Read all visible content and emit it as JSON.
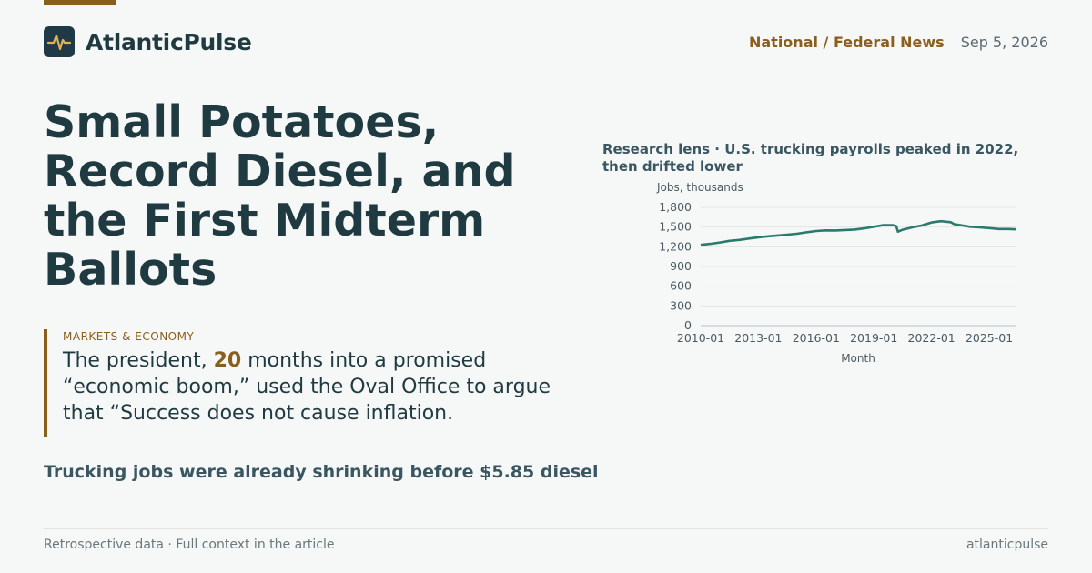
{
  "brand": {
    "name": "AtlanticPulse",
    "logo_icon": "pulse-icon"
  },
  "header": {
    "section": "National / Federal News",
    "date": "Sep 5, 2026"
  },
  "headline": "Small Potatoes, Record Diesel, and the First Midterm Ballots",
  "quote_block": {
    "kicker": "MARKETS & ECONOMY",
    "text_before": "The president, ",
    "highlight": "20",
    "text_after": " months into a promised “economic boom,” used the Oval Office to argue that “Success does not cause inflation."
  },
  "subhead": "Trucking jobs were already shrinking before $5.85 diesel",
  "footer": {
    "left": "Retrospective data · Full context in the article",
    "right": "atlanticpulse"
  },
  "colors": {
    "accent": "#8a5e1c",
    "ink": "#1f3a40",
    "line": "#2a7a6e",
    "background": "#f6f8f7"
  },
  "chart_data": {
    "type": "line",
    "title": "Research lens · U.S. trucking payrolls peaked in 2022, then drifted lower",
    "xlabel": "Month",
    "ylabel": "Jobs, thousands",
    "ylim": [
      0,
      1800
    ],
    "y_ticks": [
      "0",
      "300",
      "600",
      "900",
      "1,200",
      "1,500",
      "1,800"
    ],
    "y_tick_values": [
      0,
      300,
      600,
      900,
      1200,
      1500,
      1800
    ],
    "x_ticks": [
      "2010-01",
      "2013-01",
      "2016-01",
      "2019-01",
      "2022-01",
      "2025-01"
    ],
    "grid": true,
    "series": [
      {
        "points": [
          [
            "2010-01",
            1230
          ],
          [
            "2010-07",
            1245
          ],
          [
            "2011-01",
            1265
          ],
          [
            "2011-07",
            1290
          ],
          [
            "2012-01",
            1305
          ],
          [
            "2012-07",
            1325
          ],
          [
            "2013-01",
            1345
          ],
          [
            "2013-07",
            1360
          ],
          [
            "2014-01",
            1372
          ],
          [
            "2014-07",
            1385
          ],
          [
            "2015-01",
            1398
          ],
          [
            "2015-07",
            1420
          ],
          [
            "2016-01",
            1440
          ],
          [
            "2016-07",
            1450
          ],
          [
            "2017-01",
            1448
          ],
          [
            "2017-07",
            1455
          ],
          [
            "2018-01",
            1462
          ],
          [
            "2018-07",
            1480
          ],
          [
            "2019-01",
            1505
          ],
          [
            "2019-07",
            1530
          ],
          [
            "2020-01",
            1528
          ],
          [
            "2020-03",
            1515
          ],
          [
            "2020-04",
            1430
          ],
          [
            "2020-07",
            1460
          ],
          [
            "2021-01",
            1495
          ],
          [
            "2021-07",
            1525
          ],
          [
            "2022-01",
            1570
          ],
          [
            "2022-07",
            1590
          ],
          [
            "2023-01",
            1575
          ],
          [
            "2023-03",
            1545
          ],
          [
            "2023-07",
            1530
          ],
          [
            "2024-01",
            1505
          ],
          [
            "2024-07",
            1495
          ],
          [
            "2025-01",
            1485
          ],
          [
            "2025-07",
            1470
          ],
          [
            "2026-01",
            1470
          ],
          [
            "2026-06",
            1465
          ]
        ]
      }
    ]
  }
}
